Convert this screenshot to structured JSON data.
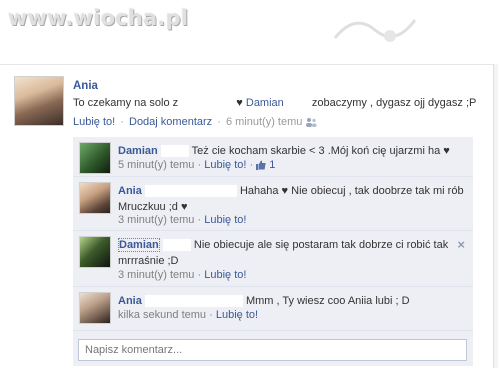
{
  "watermark": {
    "text": "www.wiocha.pl"
  },
  "post": {
    "author": "Ania",
    "text_before": "To czekamy na solo z",
    "heart": "♥",
    "mention": "Damian",
    "text_after": "zobaczymy , dygasz ojj dygasz ;P",
    "actions": {
      "like": "Lubię to!",
      "sep": "·",
      "comment": "Dodaj komentarz",
      "time": "6 minut(y) temu",
      "people_icon": "people-icon"
    }
  },
  "comments": [
    {
      "author": "Damian",
      "text": "Też cie kocham skarbie < 3 .Mój koń cię ujarzmi ha ♥",
      "time": "5 minut(y) temu",
      "sep": "·",
      "like": "Lubię to!",
      "likes_count": "1",
      "like_icon": "thumbs-up-icon"
    },
    {
      "author": "Ania",
      "text": "Hahaha ♥ Nie obiecuj , tak doobrze tak mi rób Mruczkuu ;d ♥",
      "time": "3 minut(y) temu",
      "sep": "·",
      "like": "Lubię to!"
    },
    {
      "author": "Damian",
      "text": "Nie obiecuje ale się postaram tak dobrze ci robić tak mrrraśnie ;D",
      "time": "3 minut(y) temu",
      "sep": "·",
      "like": "Lubię to!",
      "close": "×"
    },
    {
      "author": "Ania",
      "text": "Mmm , Ty wiesz coo Aniia lubi ; D",
      "time": "kilka sekund temu",
      "sep": "·",
      "like": "Lubię to!"
    }
  ],
  "comment_input": {
    "placeholder": "Napisz komentarz..."
  },
  "colors": {
    "link": "#3b5998",
    "comment_bg": "#edeff4",
    "meta": "#999999"
  }
}
